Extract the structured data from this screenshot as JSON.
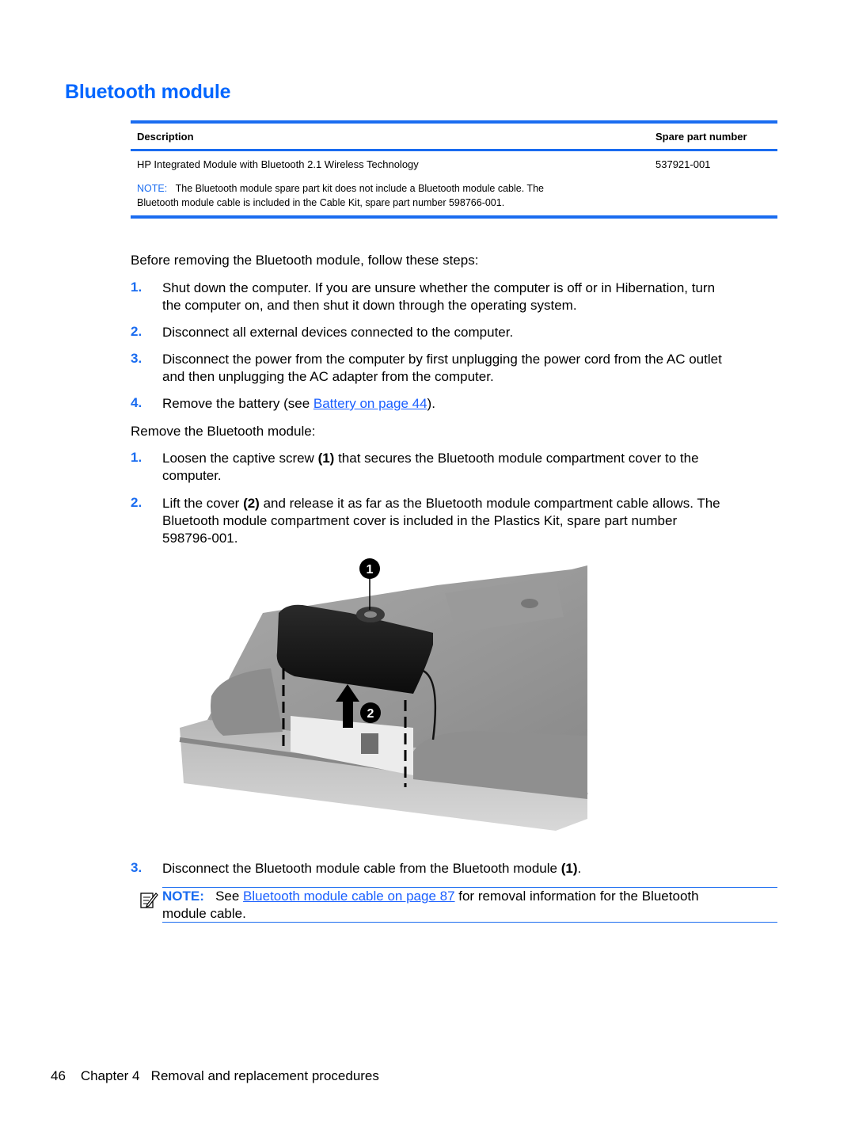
{
  "title": "Bluetooth module",
  "parts_table": {
    "headers": {
      "description": "Description",
      "spare_part_number": "Spare part number"
    },
    "rows": [
      {
        "description": "HP Integrated Module with Bluetooth 2.1 Wireless Technology",
        "spare_part_number": "537921-001"
      }
    ],
    "note": {
      "label": "NOTE:",
      "line1": "The Bluetooth module spare part kit does not include a Bluetooth module cable. The",
      "line2": "Bluetooth module cable is included in the Cable Kit, spare part number 598766-001."
    }
  },
  "prep": {
    "intro": "Before removing the Bluetooth module, follow these steps:",
    "steps": [
      {
        "num": "1.",
        "line1": "Shut down the computer. If you are unsure whether the computer is off or in Hibernation, turn",
        "line2": "the computer on, and then shut it down through the operating system."
      },
      {
        "num": "2.",
        "line1": "Disconnect all external devices connected to the computer."
      },
      {
        "num": "3.",
        "line1": "Disconnect the power from the computer by first unplugging the power cord from the AC outlet",
        "line2": "and then unplugging the AC adapter from the computer."
      },
      {
        "num": "4.",
        "pre": "Remove the battery (see ",
        "link": "Battery on page 44",
        "post": ")."
      }
    ]
  },
  "remove": {
    "intro": "Remove the Bluetooth module:",
    "steps": [
      {
        "num": "1.",
        "pre": "Loosen the captive screw ",
        "bold": "(1)",
        "post": " that secures the Bluetooth module compartment cover to the",
        "line2": "computer."
      },
      {
        "num": "2.",
        "pre": "Lift the cover ",
        "bold": "(2)",
        "post": " and release it as far as the Bluetooth module compartment cable allows. The",
        "line2": "Bluetooth module compartment cover is included in the Plastics Kit, spare part number",
        "line3": "598796-001."
      },
      {
        "num": "3.",
        "pre": "Disconnect the Bluetooth module cable from the Bluetooth module ",
        "bold": "(1)",
        "post": "."
      }
    ],
    "figure": {
      "callout1": "1",
      "callout2": "2"
    },
    "note": {
      "label": "NOTE:",
      "pre": "See ",
      "link": "Bluetooth module cable on page 87",
      "post": " for removal information for the Bluetooth",
      "line2": "module cable."
    }
  },
  "footer": {
    "page": "46",
    "chapter": "Chapter 4",
    "chapter_title": "Removal and replacement procedures"
  }
}
